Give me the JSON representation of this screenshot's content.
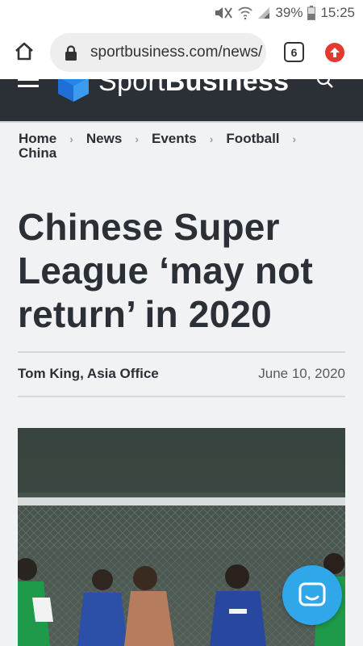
{
  "status_bar": {
    "battery": "39%",
    "time": "15:25"
  },
  "browser": {
    "url": "sportbusiness.com/news/",
    "tab_count": "6"
  },
  "site": {
    "logo_light": "Sport",
    "logo_bold": "Business"
  },
  "breadcrumb": {
    "items": [
      "Home",
      "News",
      "Events",
      "Football",
      "China"
    ]
  },
  "article": {
    "title": "Chinese Super League ‘may not return’ in 2020",
    "author": "Tom King, Asia Office",
    "date": "June 10, 2020"
  },
  "colors": {
    "header_bg": "#2b3037",
    "accent_blue": "#2fa7e8",
    "update_red": "#e23a2e"
  }
}
